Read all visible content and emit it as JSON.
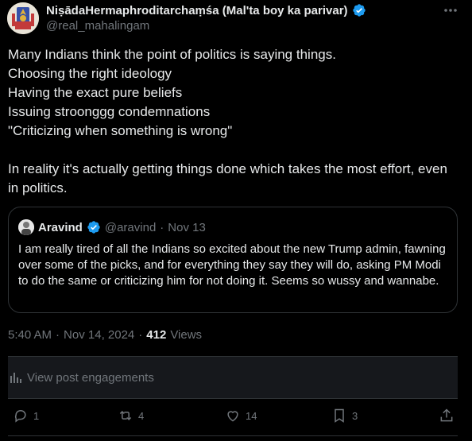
{
  "author": {
    "display_name": "NiṣādaHermaphroditarchaṃśa (Mal'ta boy ka parivar)",
    "handle": "@real_mahalingam",
    "verified_color": "#1d9bf0"
  },
  "more_icon": "more-dots-icon",
  "post_text": "Many Indians think the point of politics is saying things.\nChoosing the right ideology\nHaving the exact pure beliefs\nIssuing stroonggg condemnations\n\"Criticizing when something is wrong\"\n\nIn reality it's actually getting things done which takes the most effort, even in politics.",
  "quoted": {
    "name": "Aravind",
    "handle": "@aravind",
    "separator": "·",
    "date": "Nov 13",
    "text": "I am really tired of all the Indians so excited about the new Trump admin, fawning over some of the picks, and for everything they say they will do, asking PM Modi to do the same or criticizing him for not doing it. Seems so wussy and wannabe."
  },
  "meta": {
    "time": "5:40 AM",
    "sep1": "·",
    "date": "Nov 14, 2024",
    "sep2": "·",
    "views_count": "412",
    "views_label": "Views"
  },
  "engagements_label": "View post engagements",
  "actions": {
    "reply_count": "1",
    "repost_count": "4",
    "like_count": "14",
    "bookmark_count": "3"
  },
  "colors": {
    "background": "#000000",
    "text": "#e7e9ea",
    "muted": "#71767b",
    "border": "#2f3336",
    "accent": "#1d9bf0"
  }
}
